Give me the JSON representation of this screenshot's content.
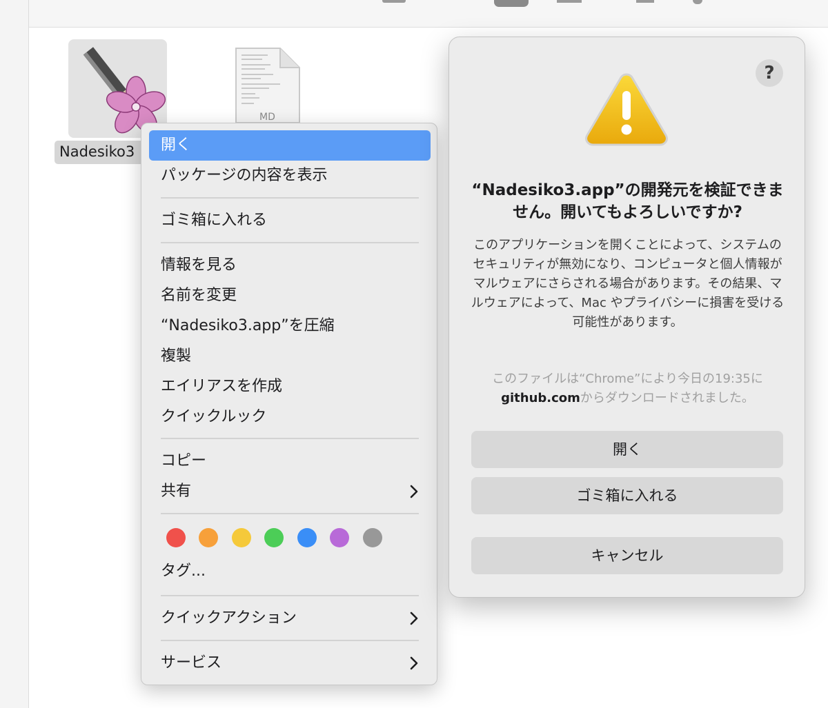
{
  "desktop": {
    "app_file": {
      "name": "Nadesiko3"
    },
    "md_file": {
      "extension": "MD"
    }
  },
  "context_menu": {
    "items": [
      {
        "label": "開く",
        "selected": true
      },
      {
        "label": "パッケージの内容を表示"
      },
      {
        "label": "ゴミ箱に入れる"
      },
      {
        "label": "情報を見る"
      },
      {
        "label": "名前を変更"
      },
      {
        "label": "“Nadesiko3.app”を圧縮"
      },
      {
        "label": "複製"
      },
      {
        "label": "エイリアスを作成"
      },
      {
        "label": "クイックルック"
      },
      {
        "label": "コピー"
      },
      {
        "label": "共有",
        "submenu": true
      },
      {
        "label": "タグ..."
      },
      {
        "label": "クイックアクション",
        "submenu": true
      },
      {
        "label": "サービス",
        "submenu": true
      }
    ],
    "tag_colors": [
      "#f0514b",
      "#f7a03a",
      "#f5c93a",
      "#4ccd57",
      "#3a8ef7",
      "#b86ad8",
      "#989898"
    ]
  },
  "alert": {
    "help_label": "?",
    "title": "“Nadesiko3.app”の開発元を検証できません。開いてもよろしいですか?",
    "body": "このアプリケーションを開くことによって、システムのセキュリティが無効になり、コンピュータと個人情報がマルウェアにさらされる場合があります。その結果、マルウェアによって、Mac やプライバシーに損害を受ける可能性があります。",
    "source_prefix": "このファイルは“Chrome”により今日の19:35に",
    "source_domain": "github.com",
    "source_suffix": "からダウンロードされました。",
    "buttons": {
      "open": "開く",
      "trash": "ゴミ箱に入れる",
      "cancel": "キャンセル"
    },
    "icon": "warning-triangle-icon"
  }
}
